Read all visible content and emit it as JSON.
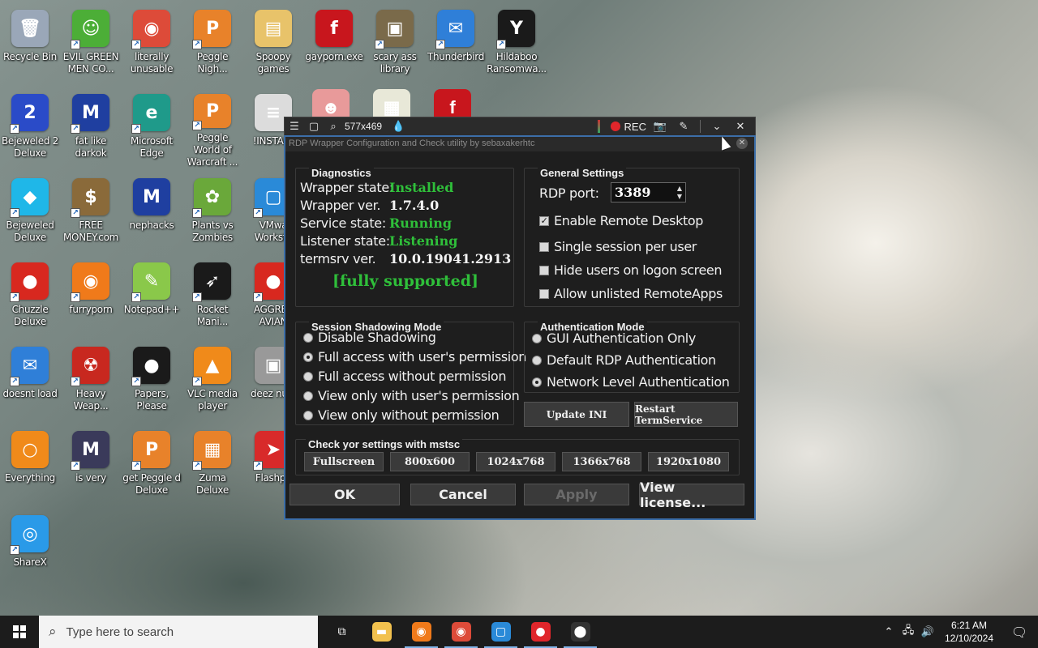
{
  "desktop": {
    "icons": [
      {
        "label": "Recycle Bin",
        "glyph": "🗑",
        "color": "#9aa7b8",
        "shortcut": false
      },
      {
        "label": "EVIL GREEN MEN CO...",
        "glyph": "☺",
        "color": "#4cae37",
        "shortcut": true
      },
      {
        "label": "literally unusable",
        "glyph": "◉",
        "color": "#dd4b39",
        "shortcut": true
      },
      {
        "label": "Peggle Nigh...",
        "glyph": "P",
        "color": "#e8822a",
        "shortcut": true
      },
      {
        "label": "Spoopy games",
        "glyph": "▤",
        "color": "#e8c36a",
        "shortcut": false
      },
      {
        "label": "gayporn.exe",
        "glyph": "f",
        "color": "#c8161d",
        "shortcut": false
      },
      {
        "label": "scary ass library",
        "glyph": "▣",
        "color": "#7a6a4a",
        "shortcut": true
      },
      {
        "label": "Thunderbird",
        "glyph": "✉",
        "color": "#2f7fd8",
        "shortcut": true
      },
      {
        "label": "Hildaboo Ransomwa...",
        "glyph": "Y",
        "color": "#1a1a1a",
        "shortcut": true
      },
      {
        "label": "Bejeweled 2 Deluxe",
        "glyph": "2",
        "color": "#2a4bc8",
        "shortcut": true
      },
      {
        "label": "fat like darkok",
        "glyph": "M",
        "color": "#1f3fa0",
        "shortcut": true
      },
      {
        "label": "Microsoft Edge",
        "glyph": "e",
        "color": "#1f9a8a",
        "shortcut": true
      },
      {
        "label": "Peggle World of Warcraft ...",
        "glyph": "P",
        "color": "#e8822a",
        "shortcut": true
      },
      {
        "label": "!INSTALL",
        "glyph": "≡",
        "color": "#dcdcdc",
        "shortcut": false
      },
      {
        "label": "Bejeweled Deluxe",
        "glyph": "◆",
        "color": "#1fb7e8",
        "shortcut": true
      },
      {
        "label": "FREE MONEY.com",
        "glyph": "$",
        "color": "#8a6a3a",
        "shortcut": true
      },
      {
        "label": "nephacks",
        "glyph": "M",
        "color": "#1f3fa0",
        "shortcut": false
      },
      {
        "label": "Plants vs Zombies",
        "glyph": "✿",
        "color": "#6aa83a",
        "shortcut": true
      },
      {
        "label": "VMwa Worksta",
        "glyph": "▢",
        "color": "#2a8ad8",
        "shortcut": true
      },
      {
        "label": "Chuzzle Deluxe",
        "glyph": "●",
        "color": "#d8281f",
        "shortcut": true
      },
      {
        "label": "furryporn",
        "glyph": "◉",
        "color": "#f07a1a",
        "shortcut": true
      },
      {
        "label": "Notepad++",
        "glyph": "✎",
        "color": "#8ac84a",
        "shortcut": true
      },
      {
        "label": "Rocket Mani...",
        "glyph": "➶",
        "color": "#1a1a1a",
        "shortcut": true
      },
      {
        "label": "AGGRES AVIAN",
        "glyph": "●",
        "color": "#d8281f",
        "shortcut": true
      },
      {
        "label": "doesnt load",
        "glyph": "✉",
        "color": "#2f7fd8",
        "shortcut": true
      },
      {
        "label": "Heavy Weap...",
        "glyph": "☢",
        "color": "#c8281f",
        "shortcut": true
      },
      {
        "label": "Papers, Please",
        "glyph": "●",
        "color": "#1a1a1a",
        "shortcut": true
      },
      {
        "label": "VLC media player",
        "glyph": "▲",
        "color": "#f08a1a",
        "shortcut": true
      },
      {
        "label": "deez nuts",
        "glyph": "▣",
        "color": "#999999",
        "shortcut": false
      },
      {
        "label": "Everything",
        "glyph": "○",
        "color": "#f08a1a",
        "shortcut": false
      },
      {
        "label": "is very",
        "glyph": "M",
        "color": "#3a3a5a",
        "shortcut": true
      },
      {
        "label": "get Peggle d Deluxe",
        "glyph": "P",
        "color": "#e8822a",
        "shortcut": true
      },
      {
        "label": "Zuma Deluxe",
        "glyph": "▦",
        "color": "#e8822a",
        "shortcut": true
      },
      {
        "label": "Flashpo",
        "glyph": "➤",
        "color": "#d82a2a",
        "shortcut": true
      },
      {
        "label": "ShareX",
        "glyph": "◎",
        "color": "#2a9ae8",
        "shortcut": true
      }
    ],
    "extra_icons": [
      {
        "glyph": "☻",
        "color": "#e89a9a"
      },
      {
        "glyph": "▦",
        "color": "#e8e8d8"
      },
      {
        "glyph": "f",
        "color": "#c8161d"
      }
    ]
  },
  "capture_toolbar": {
    "size": "577x469",
    "rec_label": "REC"
  },
  "dialog": {
    "title": "RDP Wrapper Configuration and Check utility by sebaxakerhtc",
    "diagnostics": {
      "caption": "Diagnostics",
      "rows": [
        {
          "key": "Wrapper state:",
          "value": "Installed",
          "status": "green"
        },
        {
          "key": "Wrapper ver.",
          "value": "1.7.4.0",
          "status": "white"
        },
        {
          "key": "Service state:",
          "value": "Running",
          "status": "green"
        },
        {
          "key": "Listener state:",
          "value": "Listening",
          "status": "green"
        },
        {
          "key": "termsrv ver.",
          "value": "10.0.19041.2913",
          "status": "white"
        }
      ],
      "support": "[fully supported]"
    },
    "general": {
      "caption": "General Settings",
      "port_label": "RDP port:",
      "port_value": "3389",
      "checks": [
        {
          "label": "Enable Remote Desktop",
          "checked": true
        },
        {
          "label": "Single session per user",
          "checked": false
        },
        {
          "label": "Hide users on logon screen",
          "checked": false
        },
        {
          "label": "Allow unlisted RemoteApps",
          "checked": false
        }
      ]
    },
    "shadowing": {
      "caption": "Session Shadowing Mode",
      "options": [
        {
          "label": "Disable Shadowing",
          "selected": false
        },
        {
          "label": "Full access with user's permission",
          "selected": true
        },
        {
          "label": "Full access without permission",
          "selected": false
        },
        {
          "label": "View only with user's permission",
          "selected": false
        },
        {
          "label": "View only without permission",
          "selected": false
        }
      ]
    },
    "auth": {
      "caption": "Authentication Mode",
      "options": [
        {
          "label": "GUI Authentication Only",
          "selected": false
        },
        {
          "label": "Default RDP Authentication",
          "selected": false
        },
        {
          "label": "Network Level Authentication",
          "selected": true
        }
      ]
    },
    "update_ini": "Update INI",
    "restart_service": "Restart TermService",
    "mstsc": {
      "caption": "Check yor settings with mstsc",
      "buttons": [
        "Fullscreen",
        "800x600",
        "1024x768",
        "1366x768",
        "1920x1080"
      ]
    },
    "footer": {
      "ok": "OK",
      "cancel": "Cancel",
      "apply": "Apply",
      "license": "View license..."
    }
  },
  "taskbar": {
    "search_placeholder": "Type here to search",
    "apps": [
      {
        "name": "task-view",
        "glyph": "⧉",
        "color": "#1c1c1c"
      },
      {
        "name": "file-explorer",
        "glyph": "▬",
        "color": "#f2c14e"
      },
      {
        "name": "firefox",
        "glyph": "◉",
        "color": "#f07a1a"
      },
      {
        "name": "chrome",
        "glyph": "◉",
        "color": "#dd4b39"
      },
      {
        "name": "vmware",
        "glyph": "▢",
        "color": "#2a8ad8"
      },
      {
        "name": "sharex-record",
        "glyph": "●",
        "color": "#e0262b"
      },
      {
        "name": "rdp-config",
        "glyph": "⬤",
        "color": "#333333"
      }
    ],
    "time": "6:21 AM",
    "date": "12/10/2024"
  }
}
